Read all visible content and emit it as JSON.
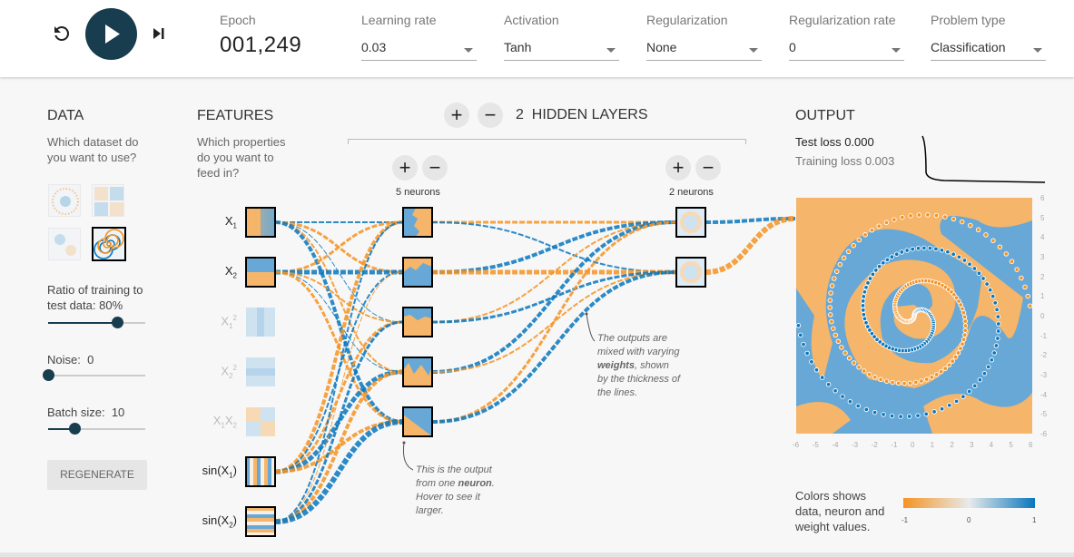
{
  "controls": {
    "reset_icon": "reset-icon",
    "play_icon": "play-icon",
    "step_icon": "step-forward-icon"
  },
  "epoch": {
    "label": "Epoch",
    "value": "001,249"
  },
  "learning_rate": {
    "label": "Learning rate",
    "value": "0.03"
  },
  "activation": {
    "label": "Activation",
    "value": "Tanh"
  },
  "regularization": {
    "label": "Regularization",
    "value": "None"
  },
  "regularization_rate": {
    "label": "Regularization rate",
    "value": "0"
  },
  "problem_type": {
    "label": "Problem type",
    "value": "Classification"
  },
  "data": {
    "title": "DATA",
    "question": "Which dataset do you want to use?",
    "datasets": [
      "circle",
      "exclusive-or",
      "gaussian",
      "spiral"
    ],
    "selected_dataset": "spiral",
    "ratio": {
      "label": "Ratio of training to test data:",
      "value": "80%",
      "fraction": 0.8
    },
    "noise": {
      "label": "Noise:",
      "value": "0",
      "fraction": 0
    },
    "batch": {
      "label": "Batch size:",
      "value": "10",
      "fraction": 0.3
    },
    "regenerate": "REGENERATE"
  },
  "features": {
    "title": "FEATURES",
    "question": "Which properties do you want to feed in?",
    "items": [
      {
        "base": "X",
        "sub": "1",
        "sup": "",
        "active": true
      },
      {
        "base": "X",
        "sub": "2",
        "sup": "",
        "active": true
      },
      {
        "base": "X",
        "sub": "1",
        "sup": "2",
        "active": false
      },
      {
        "base": "X",
        "sub": "2",
        "sup": "2",
        "active": false
      },
      {
        "base": "X",
        "sub": "1",
        "base2": "X",
        "sub2": "2",
        "active": false
      },
      {
        "base": "sin(X",
        "sub": "1",
        "suffix": ")",
        "active": true
      },
      {
        "base": "sin(X",
        "sub": "2",
        "suffix": ")",
        "active": true
      }
    ]
  },
  "hidden": {
    "count": "2",
    "title": "HIDDEN LAYERS",
    "plus": "+",
    "minus": "−",
    "layers": [
      {
        "neurons": "5 neurons"
      },
      {
        "neurons": "2 neurons"
      }
    ]
  },
  "notes": {
    "weights": [
      "The outputs are",
      "mixed with varying",
      "weights",
      ", shown",
      "by the thickness of",
      "the lines."
    ],
    "neuron": [
      "This is the output",
      "from one",
      "neuron",
      ".",
      "Hover to see it",
      "larger."
    ]
  },
  "output": {
    "title": "OUTPUT",
    "test_loss_label": "Test loss",
    "test_loss": "0.000",
    "train_loss_label": "Training loss",
    "train_loss": "0.003",
    "y_ticks": [
      "6",
      "5",
      "4",
      "3",
      "2",
      "1",
      "0",
      "-1",
      "-2",
      "-3",
      "-4",
      "-5",
      "-6"
    ],
    "x_ticks": [
      "-6",
      "-5",
      "-4",
      "-3",
      "-2",
      "-1",
      "0",
      "1",
      "2",
      "3",
      "4",
      "5",
      "6"
    ],
    "legend_text": "Colors shows data, neuron and weight values.",
    "legend_ticks": [
      "-1",
      "0",
      "1"
    ]
  },
  "colors": {
    "orange": "#f59322",
    "blue": "#0877bd",
    "dark": "#183D4E",
    "region_orange": "#f5b56a",
    "region_blue": "#67a8d6"
  }
}
